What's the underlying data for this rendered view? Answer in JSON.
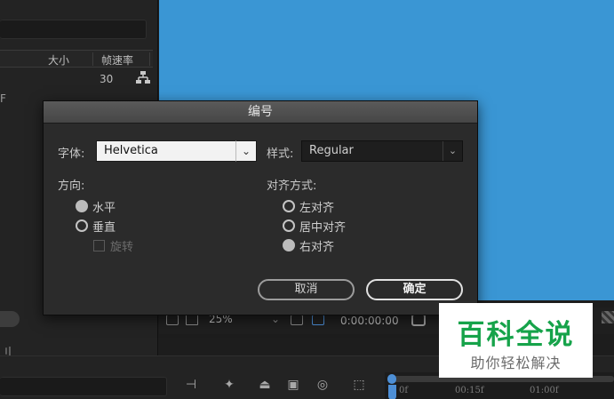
{
  "left_panel": {
    "col_size": "大小",
    "col_fps": "帧速率",
    "fps_value": "30",
    "stub_text": "F",
    "stub_text2": "刂"
  },
  "viewer": {
    "zoom": "25%",
    "timecode": "0:00:00:00"
  },
  "timeline": {
    "ticks": [
      "0f",
      "00:15f",
      "01:00f"
    ]
  },
  "dialog": {
    "title": "编号",
    "font_label": "字体:",
    "font_value": "Helvetica",
    "style_label": "样式:",
    "style_value": "Regular",
    "direction_label": "方向:",
    "direction_options": [
      "水平",
      "垂直"
    ],
    "direction_selected": "水平",
    "rotate_label": "旋转",
    "align_label": "对齐方式:",
    "align_options": [
      "左对齐",
      "居中对齐",
      "右对齐"
    ],
    "align_selected": "右对齐",
    "cancel": "取消",
    "ok": "确定"
  },
  "watermark": {
    "title": "百科全说",
    "subtitle": "助你轻松解决"
  }
}
